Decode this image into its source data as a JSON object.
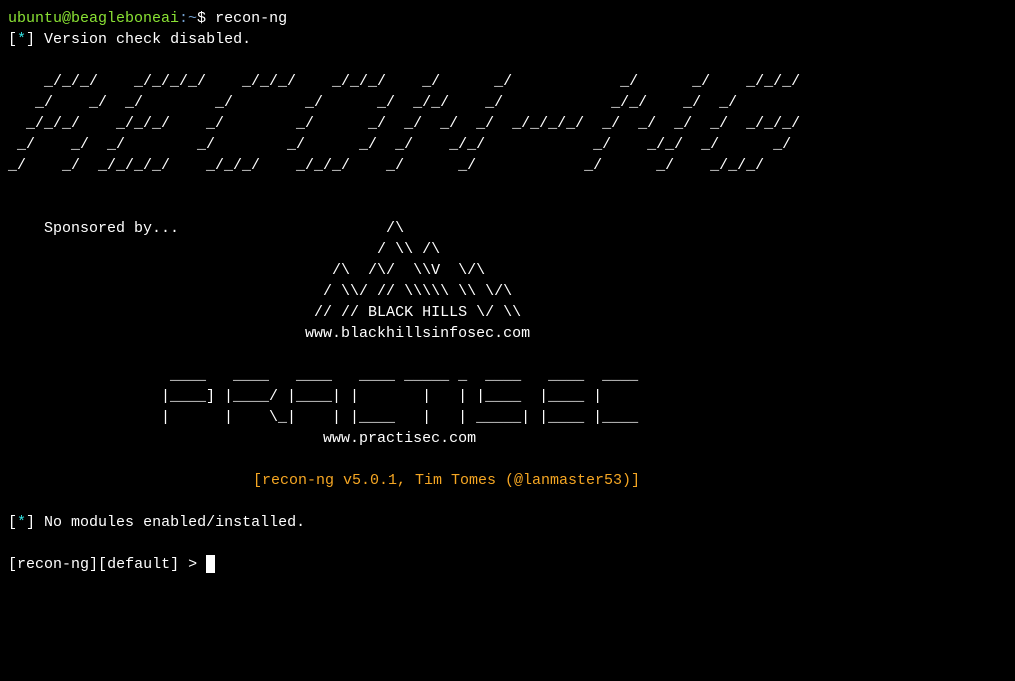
{
  "prompt": {
    "user_host": "ubuntu@beagleboneai",
    "path": ":~",
    "symbol": "$",
    "command": "recon-ng"
  },
  "status1": {
    "marker_l": "[",
    "marker_star": "*",
    "marker_r": "]",
    "text": " Version check disabled."
  },
  "ascii_recon": "    _/_/_/    _/_/_/_/    _/_/_/    _/_/_/    _/      _/            _/      _/    _/_/_/\n   _/    _/  _/        _/        _/      _/  _/_/    _/            _/_/    _/  _/       \n  _/_/_/    _/_/_/    _/        _/      _/  _/  _/  _/  _/_/_/_/  _/  _/  _/  _/  _/_/_/\n _/    _/  _/        _/        _/      _/  _/    _/_/            _/    _/_/  _/      _/ \n_/    _/  _/_/_/_/    _/_/_/    _/_/_/    _/      _/            _/      _/    _/_/_/    ",
  "sponsored_label": "    Sponsored by...",
  "ascii_blackhills": "                                          /\\\n                                         / \\\\ /\\\n                                    /\\  /\\/  \\\\V  \\/\\\n                                   / \\\\/ // \\\\\\\\\\ \\\\ \\/\\\n                                  // // BLACK HILLS \\/ \\\\\n                                 www.blackhillsinfosec.com",
  "ascii_practisec": "                  ____   ____   ____   ____ _____ _  ____   ____  ____\n                 |____] |____/ |____| |       |   | |____  |____ |    \n                 |      |    \\_|    | |____   |   | _____| |____ |____\n                                   www.practisec.com",
  "credits": "[recon-ng v5.0.1, Tim Tomes (@lanmaster53)]",
  "status2": {
    "marker_l": "[",
    "marker_star": "*",
    "marker_r": "]",
    "text": " No modules enabled/installed."
  },
  "shell_prompt": {
    "bracket_l1": "[",
    "app": "recon-ng",
    "bracket_r1": "]",
    "bracket_l2": "[",
    "context": "default",
    "bracket_r2": "]",
    "arrow": " > "
  }
}
